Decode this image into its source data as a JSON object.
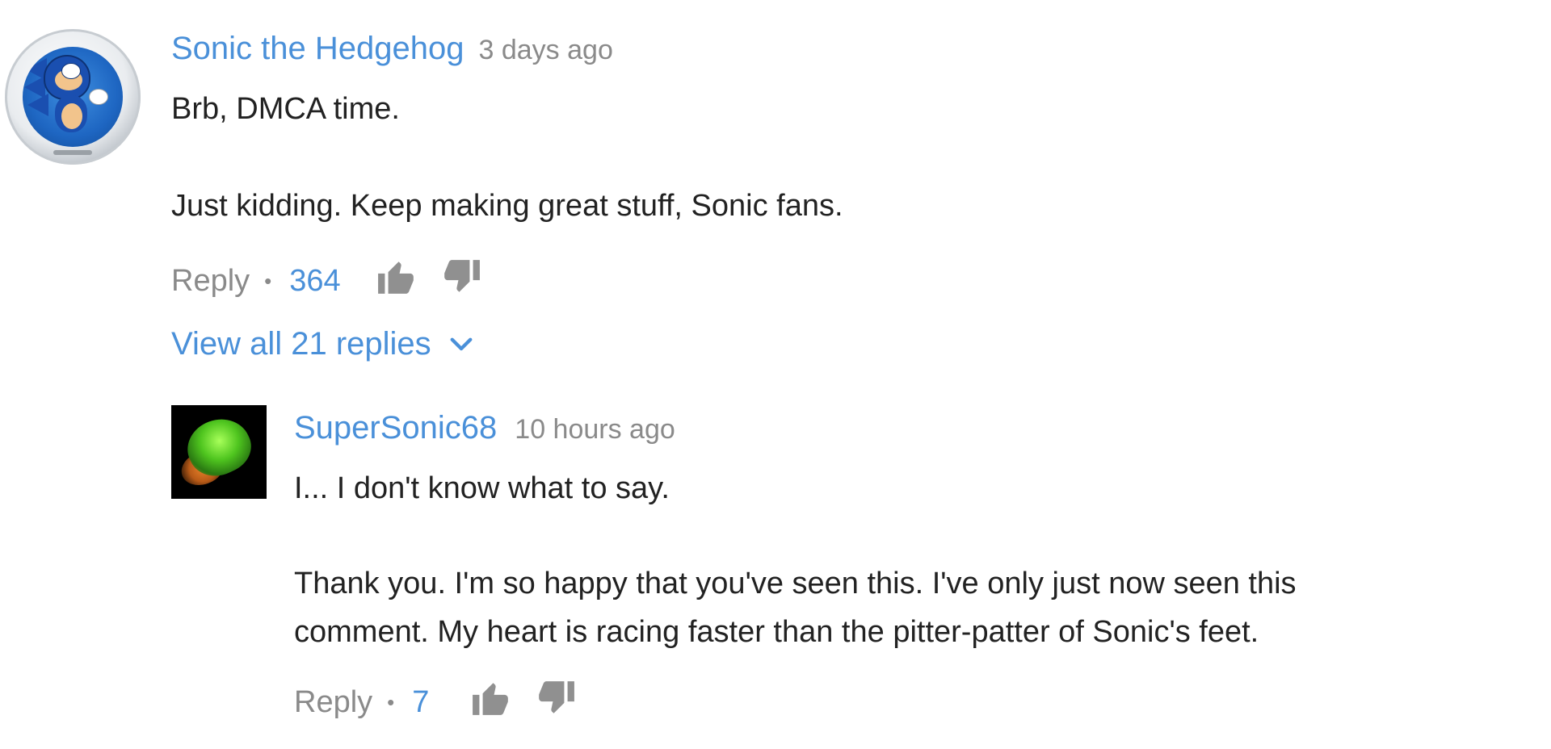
{
  "comment": {
    "author": "Sonic the Hedgehog",
    "timestamp": "3 days ago",
    "line1": "Brb, DMCA time.",
    "line2": "Just kidding. Keep making great stuff, Sonic fans.",
    "reply_label": "Reply",
    "separator": "•",
    "likes": "364",
    "view_replies": "View all 21 replies"
  },
  "reply": {
    "author": "SuperSonic68",
    "timestamp": "10 hours ago",
    "line1": "I... I don't know what to say.",
    "line2": "Thank you. I'm so happy that you've seen this. I've only just now seen this",
    "line3": "comment. My heart is racing faster than the pitter-patter of Sonic's feet.",
    "reply_label": "Reply",
    "separator": "•",
    "likes": "7"
  },
  "colors": {
    "author_link": "#4a90d9",
    "muted": "#8a8a8a",
    "body": "#222222",
    "icon": "#909090"
  },
  "icons": {
    "like": "thumbs-up-icon",
    "dislike": "thumbs-down-icon",
    "expand": "chevron-down-icon"
  }
}
